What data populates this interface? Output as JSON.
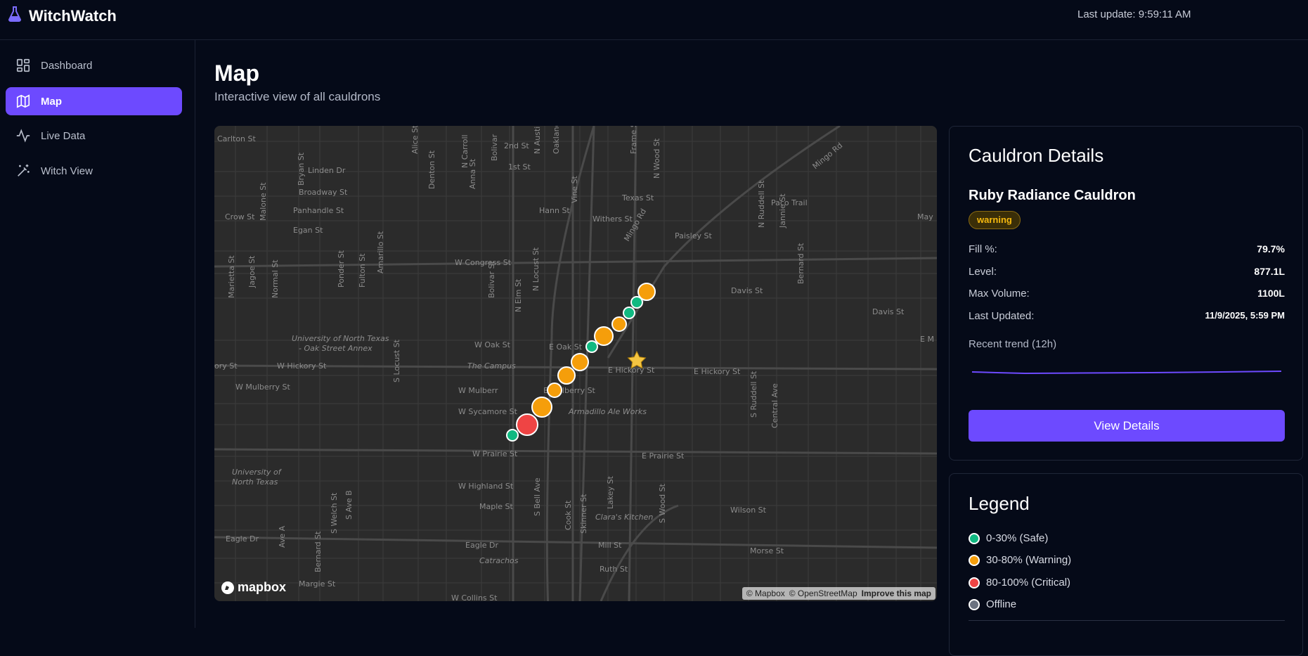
{
  "app": {
    "name": "WitchWatch",
    "logo_icon": "flask-icon",
    "last_update": "Last update: 9:59:11 AM"
  },
  "sidebar": {
    "items": [
      {
        "label": "Dashboard",
        "icon": "dashboard-grid-icon",
        "active": false
      },
      {
        "label": "Map",
        "icon": "map-icon",
        "active": true
      },
      {
        "label": "Live Data",
        "icon": "activity-icon",
        "active": false
      },
      {
        "label": "Witch View",
        "icon": "magic-wand-icon",
        "active": false
      }
    ]
  },
  "page": {
    "title": "Map",
    "subtitle": "Interactive view of all cauldrons"
  },
  "map": {
    "streets": [
      "Carlton St",
      "Linden Dr",
      "Broadway St",
      "Crow St",
      "Panhandle St",
      "Egan St",
      "Hann St",
      "Withers St",
      "Texas St",
      "Paco Trail",
      "May",
      "Paisley St",
      "W Congress St",
      "Davis St",
      "Davis St",
      "W Oak St",
      "E Oak St",
      "E M",
      "W Hickory St",
      "ory St",
      "E Hickory St",
      "E Hickory St",
      "W Mulberry St",
      "W Mulberr",
      "E Mulberry St",
      "Armadillo Ale Works",
      "W Sycamore St",
      "W Prairie St",
      "E Prairie St",
      "W Highland St",
      "Maple St",
      "Wilson St",
      "Eagle Dr",
      "Eagle Dr",
      "Clara's Kitchen",
      "Mill St",
      "Morse St",
      "Catrachos",
      "Ruth St",
      "Margie St",
      "W Collins St",
      "2nd St",
      "1st St",
      "University of North Texas",
      "- Oak Street Annex",
      "The Campus",
      "University of",
      "North Texas",
      "Mingo Rd",
      "Mingo Rd",
      "N Carroll",
      "Anna St",
      "Bolivar",
      "Alice St",
      "Denton St",
      "Bryan St",
      "Malone St",
      "Marietta St",
      "Jagoe St",
      "Normal St",
      "Ponder St",
      "Fulton St",
      "Amarillo St",
      "Bolivar St",
      "N Elm St",
      "N Locust St",
      "N Austin",
      "Oakland St",
      "Vine St",
      "Frame St",
      "N Wood St",
      "N Ruddell St",
      "Jannie St",
      "Bernard St",
      "S Locust St",
      "S Bell Ave",
      "Cook St",
      "Skinner St",
      "Lakey St",
      "S Wood St",
      "S Ruddell St",
      "Central Ave",
      "S Welch St",
      "S Ave B",
      "Ave A",
      "Bernard St"
    ],
    "attribution": {
      "mapbox": "© Mapbox",
      "osm": "© OpenStreetMap",
      "improve": "Improve this map",
      "logo": "mapbox"
    },
    "cauldrons": [
      {
        "status": "safe"
      },
      {
        "status": "critical"
      },
      {
        "status": "warning"
      },
      {
        "status": "warning"
      },
      {
        "status": "warning"
      },
      {
        "status": "warning"
      },
      {
        "status": "safe"
      },
      {
        "status": "warning"
      },
      {
        "status": "warning"
      },
      {
        "status": "safe"
      },
      {
        "status": "safe"
      },
      {
        "status": "warning"
      }
    ],
    "market_icon": "star-icon"
  },
  "details": {
    "title": "Cauldron Details",
    "name": "Ruby Radiance Cauldron",
    "status": "warning",
    "rows": [
      {
        "label": "Fill %:",
        "value": "79.7%"
      },
      {
        "label": "Level:",
        "value": "877.1L"
      },
      {
        "label": "Max Volume:",
        "value": "1100L"
      },
      {
        "label": "Last Updated:",
        "value": "11/9/2025, 5:59 PM"
      }
    ],
    "trend_label": "Recent trend (12h)",
    "button": "View Details"
  },
  "legend": {
    "title": "Legend",
    "items": [
      {
        "label": "0-30% (Safe)",
        "color": "#10b981"
      },
      {
        "label": "30-80% (Warning)",
        "color": "#f59e0b"
      },
      {
        "label": "80-100% (Critical)",
        "color": "#ef4444"
      },
      {
        "label": "Offline",
        "color": "#6b7280"
      }
    ]
  },
  "colors": {
    "accent": "#6d4aff",
    "safe": "#10b981",
    "warning": "#f59e0b",
    "critical": "#ef4444",
    "offline": "#6b7280"
  }
}
